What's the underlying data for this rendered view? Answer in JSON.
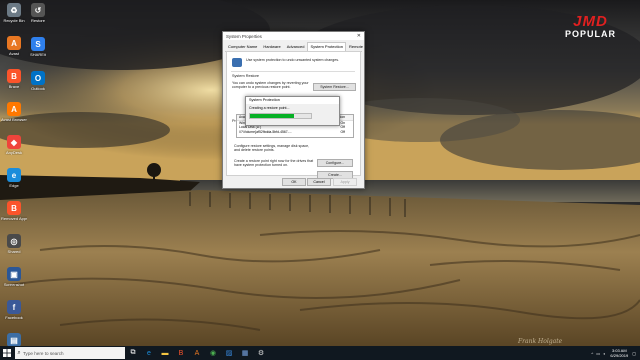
{
  "watermark": {
    "line1": "JMD",
    "line2": "POPULAR"
  },
  "signature": "Frank Holgate",
  "desktop_icons": [
    {
      "label": "Recycle Bin",
      "icon": "recycle-bin-icon",
      "color": "#6c7a86"
    },
    {
      "label": "Restore",
      "icon": "restore-icon",
      "color": "#555"
    },
    {
      "label": "Avast",
      "icon": "avast-icon",
      "color": "#e87722"
    },
    {
      "label": "SHAREit",
      "icon": "shareit-icon",
      "color": "#2f80ed"
    },
    {
      "label": "Brave",
      "icon": "brave-icon",
      "color": "#fb542b"
    },
    {
      "label": "Outlook",
      "icon": "outlook-icon",
      "color": "#0072c6"
    },
    {
      "label": "Avast Browser",
      "icon": "avast-browser-icon",
      "color": "#ff7800"
    },
    {
      "label": "AnyDesk",
      "icon": "anydesk-icon",
      "color": "#ef443b"
    },
    {
      "label": "Edge",
      "icon": "edge-icon",
      "color": "#1b8ddb"
    },
    {
      "label": "Removed Apps",
      "icon": "brave-removed-icon",
      "color": "#fb542b"
    },
    {
      "label": "Shared",
      "icon": "app-icon",
      "color": "#4a4a4a"
    },
    {
      "label": "Screenshot",
      "icon": "screenshot-icon",
      "color": "#2b5797"
    },
    {
      "label": "Facebook",
      "icon": "facebook-icon",
      "color": "#3b5998"
    },
    {
      "label": "Documents",
      "icon": "documents-icon",
      "color": "#3c6ea5"
    }
  ],
  "dialog": {
    "title": "System Properties",
    "tabs": [
      "Computer Name",
      "Hardware",
      "Advanced",
      "System Protection",
      "Remote"
    ],
    "active_tab": "System Protection",
    "intro": "Use system protection to undo unwanted system changes.",
    "restore_section": "System Restore",
    "restore_text": "You can undo system changes by reverting your computer to a previous restore point.",
    "restore_button": "System Restore...",
    "protection_section": "Protection Settings",
    "list_header": [
      "Available Drives",
      "Protection"
    ],
    "drives": [
      {
        "name": "Windows (C:) (System)",
        "status": "On"
      },
      {
        "name": "Local Disk (D:)",
        "status": "Off"
      },
      {
        "name": "\\\\?\\Volume{af52fbdda-5bfd-4567-...",
        "status": "Off"
      }
    ],
    "configure_text": "Configure restore settings, manage disk space, and delete restore points.",
    "configure_button": "Configure...",
    "create_text": "Create a restore point right now for the drives that have system protection turned on.",
    "create_button": "Create...",
    "ok": "OK",
    "cancel": "Cancel",
    "apply": "Apply"
  },
  "progress_dialog": {
    "title": "System Protection",
    "message": "Creating a restore point...",
    "progress": 0.72
  },
  "taskbar": {
    "search_placeholder": "Type here to search",
    "apps": [
      "task-view-icon",
      "edge-icon",
      "file-explorer-icon",
      "brave-icon",
      "avast-icon",
      "chrome-icon",
      "photos-icon",
      "store-icon",
      "settings-icon"
    ],
    "time": "3:03 AM",
    "date": "6/29/2019"
  }
}
